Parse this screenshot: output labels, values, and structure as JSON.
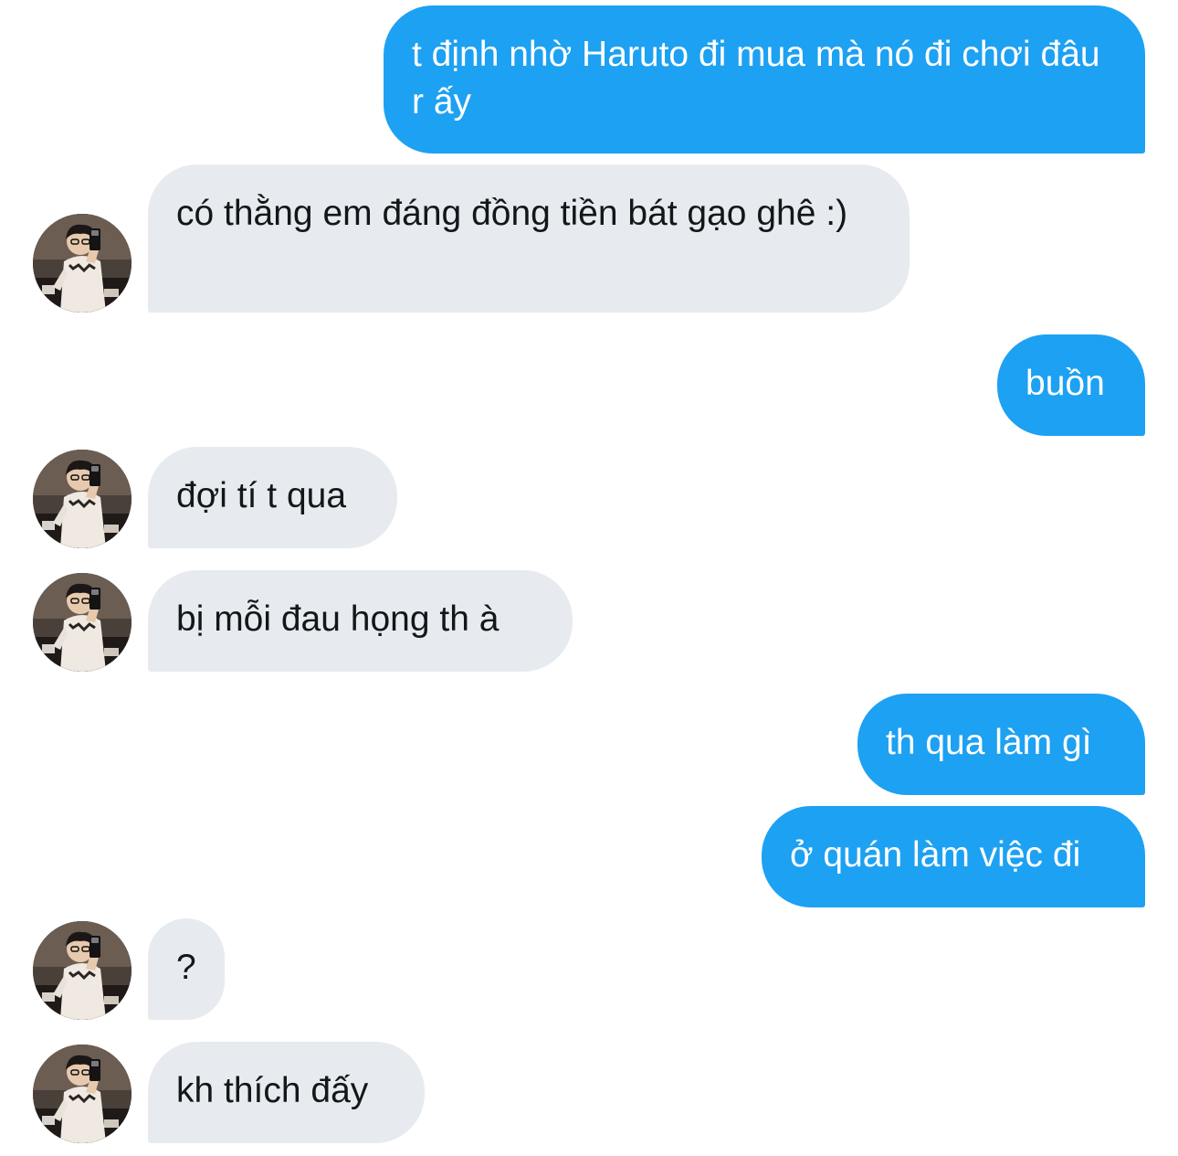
{
  "conversation": {
    "messages": [
      {
        "id": "m1",
        "direction": "sent",
        "text": "t định nhờ Haruto đi mua mà nó đi chơi đâu r ấy"
      },
      {
        "id": "m2",
        "direction": "received",
        "text": "có thằng em đáng đồng tiền bát gạo ghê :)",
        "avatar": "user-avatar-photo"
      },
      {
        "id": "m3",
        "direction": "sent",
        "text": "buồn"
      },
      {
        "id": "m4",
        "direction": "received",
        "text": "đợi tí t qua",
        "avatar": "user-avatar-photo"
      },
      {
        "id": "m5",
        "direction": "received",
        "text": "bị mỗi đau họng th à",
        "avatar": "user-avatar-photo"
      },
      {
        "id": "m6",
        "direction": "sent",
        "text": "th qua làm gì"
      },
      {
        "id": "m7",
        "direction": "sent",
        "text": "ở quán làm việc đi"
      },
      {
        "id": "m8",
        "direction": "received",
        "text": "?",
        "avatar": "user-avatar-photo"
      },
      {
        "id": "m9",
        "direction": "received",
        "text": "kh thích đấy",
        "avatar": "user-avatar-photo"
      }
    ]
  },
  "colors": {
    "sent_bubble": "#1da1f2",
    "received_bubble": "#e7ebef",
    "sent_text": "#ffffff",
    "received_text": "#14171a",
    "background": "#ffffff"
  }
}
